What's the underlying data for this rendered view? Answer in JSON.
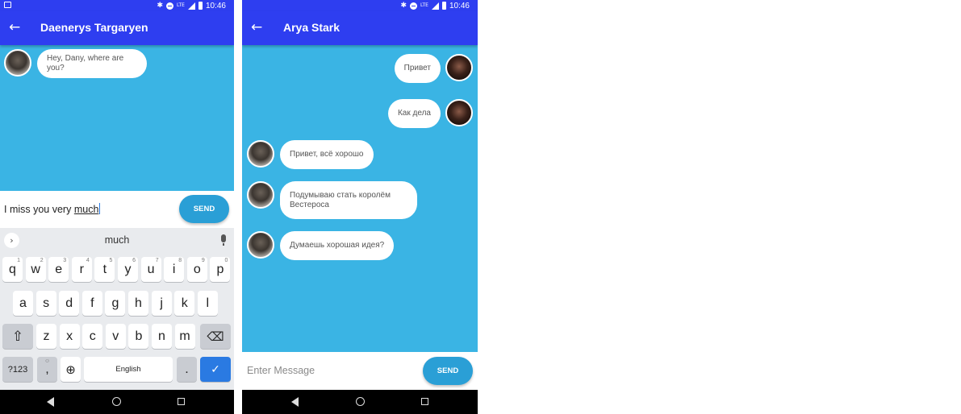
{
  "colors": {
    "appbar": "#2e3ef0",
    "chat_bg": "#3ab4e4",
    "send": "#2a9fd6",
    "check_key": "#2a7ae2"
  },
  "status_bar": {
    "time": "10:46",
    "network": "LTE"
  },
  "screen1": {
    "back_icon": "arrow-left-icon",
    "title": "Daenerys Targaryen",
    "messages": [
      {
        "sender": "other",
        "text": "Hey, Dany, where are you?"
      }
    ],
    "input": {
      "typed": "I miss you very ",
      "composing": "much"
    },
    "send_label": "SEND",
    "keyboard": {
      "suggestion": "much",
      "row1": [
        {
          "k": "q",
          "h": "1"
        },
        {
          "k": "w",
          "h": "2"
        },
        {
          "k": "e",
          "h": "3"
        },
        {
          "k": "r",
          "h": "4"
        },
        {
          "k": "t",
          "h": "5"
        },
        {
          "k": "y",
          "h": "6"
        },
        {
          "k": "u",
          "h": "7"
        },
        {
          "k": "i",
          "h": "8"
        },
        {
          "k": "o",
          "h": "9"
        },
        {
          "k": "p",
          "h": "0"
        }
      ],
      "row2": [
        "a",
        "s",
        "d",
        "f",
        "g",
        "h",
        "j",
        "k",
        "l"
      ],
      "row3": [
        "z",
        "x",
        "c",
        "v",
        "b",
        "n",
        "m"
      ],
      "sym_label": "?123",
      "comma": ",",
      "space_label": "English",
      "period": "."
    }
  },
  "screen2": {
    "back_icon": "arrow-left-icon",
    "title": "Arya Stark",
    "messages": [
      {
        "sender": "me",
        "text": "Привет"
      },
      {
        "sender": "me",
        "text": "Как дела"
      },
      {
        "sender": "other",
        "text": "Привет, всё хорошо"
      },
      {
        "sender": "other",
        "text": "Подумываю стать королём Вестероса"
      },
      {
        "sender": "other",
        "text": "Думаешь хорошая идея?"
      }
    ],
    "input_placeholder": "Enter Message",
    "send_label": "SEND"
  }
}
